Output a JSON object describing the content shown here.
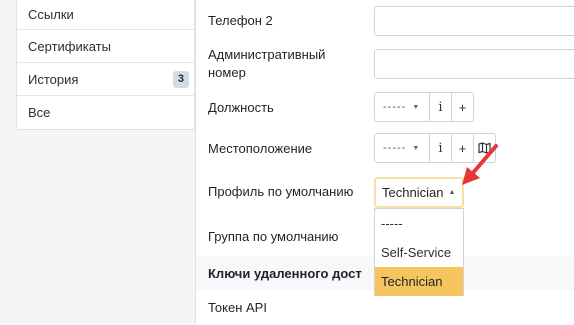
{
  "sidebar": {
    "items": [
      {
        "label": "Ссылки"
      },
      {
        "label": "Сертификаты"
      },
      {
        "label": "История",
        "badge": "3"
      },
      {
        "label": "Все"
      }
    ]
  },
  "form": {
    "phone2_label": "Телефон 2",
    "admin_number_label": "Административный номер",
    "position_label": "Должность",
    "position_value": "-----",
    "location_label": "Местоположение",
    "location_value": "-----",
    "default_profile_label": "Профиль по умолчанию",
    "default_profile_value": "Technician",
    "default_group_label": "Группа по умолчанию",
    "remote_keys_heading": "Ключи удаленного дост",
    "api_token_label": "Токен API"
  },
  "profile_dropdown": {
    "options": [
      "-----",
      "Self-Service",
      "Technician"
    ],
    "selected": "Technician"
  },
  "icons": {
    "info": "i",
    "add": "+",
    "map": "map-icon",
    "caret": "▼",
    "caret_up": "▲"
  },
  "colors": {
    "highlight": "#f7c55e",
    "arrow": "#e53935"
  }
}
